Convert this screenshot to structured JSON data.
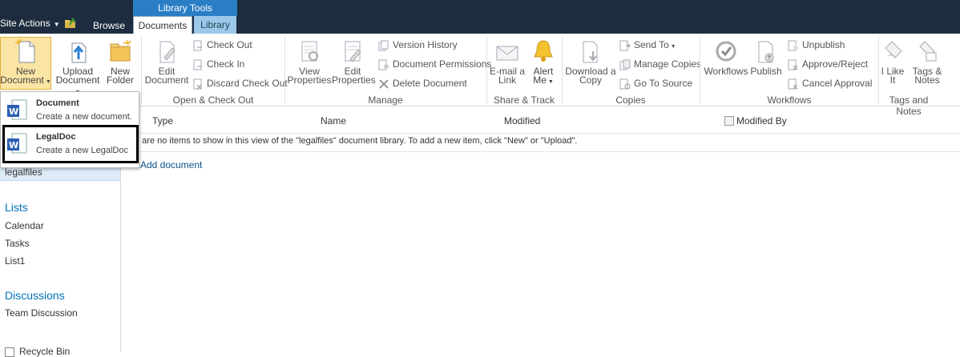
{
  "top": {
    "site_actions": "Site Actions",
    "browse": "Browse",
    "library_tools": "Library Tools",
    "tab_documents": "Documents",
    "tab_library": "Library"
  },
  "ribbon": {
    "new_document": [
      "New",
      "Document"
    ],
    "upload_document": [
      "Upload",
      "Document"
    ],
    "new_folder": [
      "New",
      "Folder"
    ],
    "edit_document": [
      "Edit",
      "Document"
    ],
    "check_out": "Check Out",
    "check_in": "Check In",
    "discard_check_out": "Discard Check Out",
    "group_open_checkout": "Open & Check Out",
    "view_properties": [
      "View",
      "Properties"
    ],
    "edit_properties": [
      "Edit",
      "Properties"
    ],
    "version_history": "Version History",
    "document_permissions": "Document Permissions",
    "delete_document": "Delete Document",
    "group_manage": "Manage",
    "email_link": [
      "E-mail a",
      "Link"
    ],
    "alert_me": [
      "Alert",
      "Me"
    ],
    "group_share": "Share & Track",
    "download_copy": [
      "Download a",
      "Copy"
    ],
    "send_to": "Send To",
    "manage_copies": "Manage Copies",
    "go_to_source": "Go To Source",
    "group_copies": "Copies",
    "workflows": "Workflows",
    "publish": "Publish",
    "unpublish": "Unpublish",
    "approve_reject": "Approve/Reject",
    "cancel_approval": "Cancel Approval",
    "group_workflows": "Workflows",
    "i_like_it": [
      "I Like",
      "It"
    ],
    "tags_notes": [
      "Tags &",
      "Notes"
    ],
    "group_tags": "Tags and Notes"
  },
  "dropdown": {
    "items": [
      {
        "title": "Document",
        "subtitle": "Create a new document."
      },
      {
        "title": "LegalDoc",
        "subtitle": "Create a new LegalDoc"
      }
    ]
  },
  "leftnav": {
    "selected": "legalfiles",
    "lists_heading": "Lists",
    "lists": [
      "Calendar",
      "Tasks",
      "List1"
    ],
    "discussions_heading": "Discussions",
    "discussions": [
      "Team Discussion"
    ],
    "recycle_bin": "Recycle Bin"
  },
  "list": {
    "columns": [
      "Type",
      "Name",
      "Modified",
      "Modified By"
    ],
    "empty_message": "e are no items to show in this view of the \"legalfiles\" document library. To add a new item, click \"New\" or \"Upload\".",
    "add_document": "Add document"
  },
  "colors": {
    "topbar": "#1d2d3f",
    "library_tools": "#2a7fc4",
    "nav_heading": "#0072bc",
    "highlight": "#fbe5a4"
  }
}
